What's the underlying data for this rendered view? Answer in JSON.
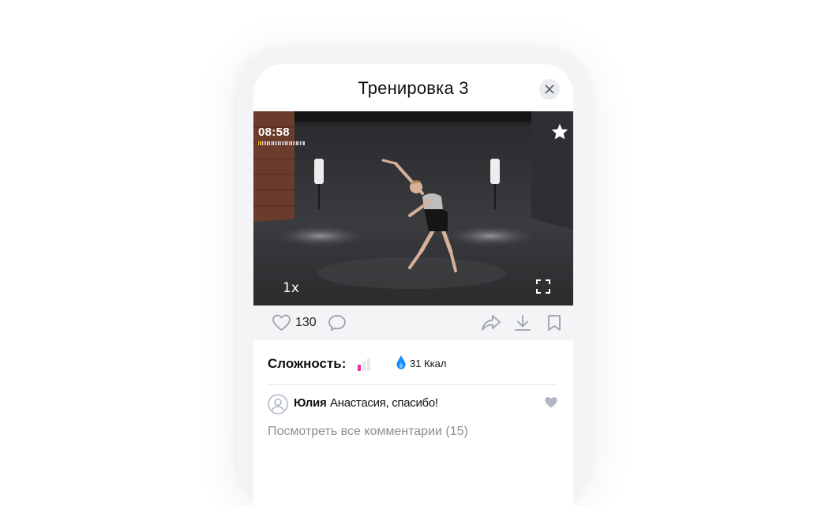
{
  "header": {
    "title": "Тренировка 3",
    "close_icon": "close-icon"
  },
  "video": {
    "timer": "08:58",
    "timer_progress_bars": {
      "total": 26,
      "filled": 2
    },
    "speed": "1x",
    "favorite_icon": "star-icon",
    "fullscreen_icon": "fullscreen-icon"
  },
  "actions": {
    "likes": "130",
    "icons": [
      "heart-icon",
      "comment-icon",
      "share-icon",
      "download-icon",
      "bookmark-icon"
    ]
  },
  "info": {
    "difficulty_label": "Сложность:",
    "difficulty_level": {
      "value": 1,
      "max": 3
    },
    "calories": "31 Ккал",
    "calories_icon": "flame-drop-icon"
  },
  "comments": {
    "first": {
      "author": "Юлия",
      "text": "Анастасия, спасибо!"
    },
    "view_all": "Посмотреть все комментарии (15)"
  },
  "colors": {
    "accent_blue": "#1a8cff",
    "difficulty_active": "#e0308a",
    "difficulty_inactive": "#e6e7eb",
    "icon_gray": "#99a2ad",
    "timer_progress": "#f0b400"
  }
}
